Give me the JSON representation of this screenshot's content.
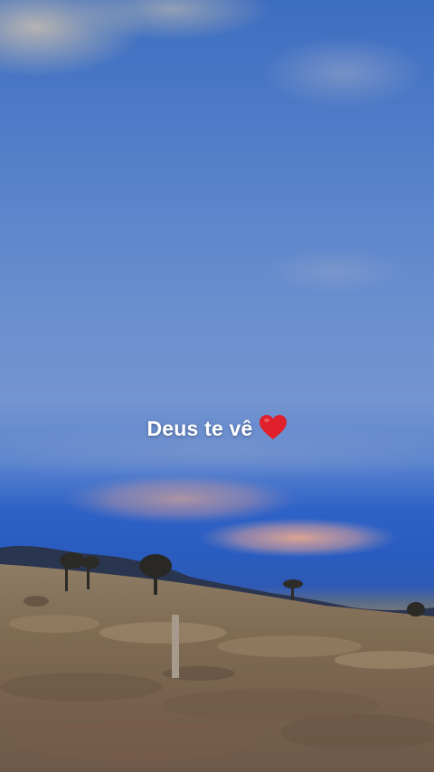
{
  "story": {
    "caption": "Deus te vê",
    "emoji": "heart-icon"
  },
  "colors": {
    "sky": "#4a78c6",
    "caption_text": "#ffffff",
    "heart": "#e0202a"
  }
}
